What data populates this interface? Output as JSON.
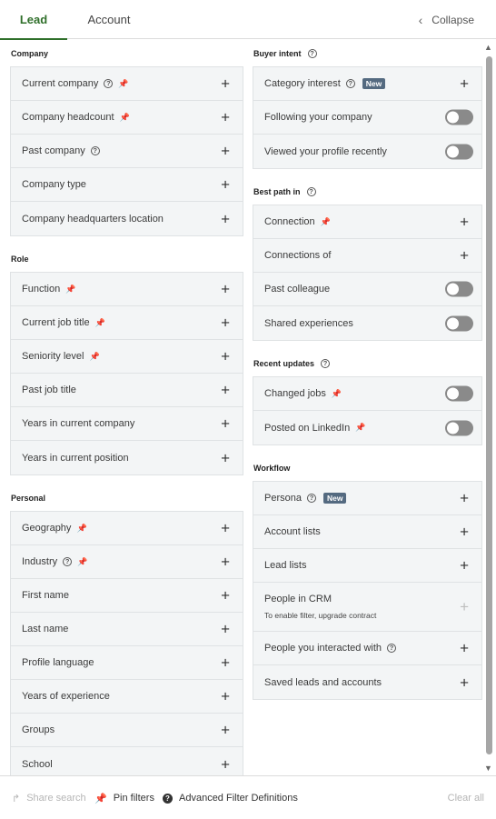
{
  "tabs": {
    "lead": "Lead",
    "account": "Account",
    "collapse": "Collapse"
  },
  "left": {
    "company": {
      "title": "Company",
      "rows": [
        "Current company",
        "Company headcount",
        "Past company",
        "Company type",
        "Company headquarters location"
      ]
    },
    "role": {
      "title": "Role",
      "rows": [
        "Function",
        "Current job title",
        "Seniority level",
        "Past job title",
        "Years in current company",
        "Years in current position"
      ]
    },
    "personal": {
      "title": "Personal",
      "rows": [
        "Geography",
        "Industry",
        "First name",
        "Last name",
        "Profile language",
        "Years of experience",
        "Groups",
        "School"
      ]
    }
  },
  "right": {
    "buyer_intent": {
      "title": "Buyer intent",
      "rows": [
        "Category interest",
        "Following your company",
        "Viewed your profile recently"
      ],
      "new_badge": "New"
    },
    "best_path": {
      "title": "Best path in",
      "rows": [
        "Connection",
        "Connections of",
        "Past colleague",
        "Shared experiences"
      ]
    },
    "recent_updates": {
      "title": "Recent updates",
      "rows": [
        "Changed jobs",
        "Posted on LinkedIn"
      ]
    },
    "workflow": {
      "title": "Workflow",
      "rows": [
        "Persona",
        "Account lists",
        "Lead lists",
        "People in CRM",
        "People you interacted with",
        "Saved leads and accounts"
      ],
      "new_badge": "New",
      "crm_note": "To enable filter, upgrade contract"
    }
  },
  "footer": {
    "share": "Share search",
    "pin": "Pin filters",
    "advanced": "Advanced Filter Definitions",
    "clear": "Clear all"
  },
  "colors": {
    "accent": "#2f6f2a",
    "badge": "#546a80",
    "row_bg": "#f3f5f6"
  }
}
